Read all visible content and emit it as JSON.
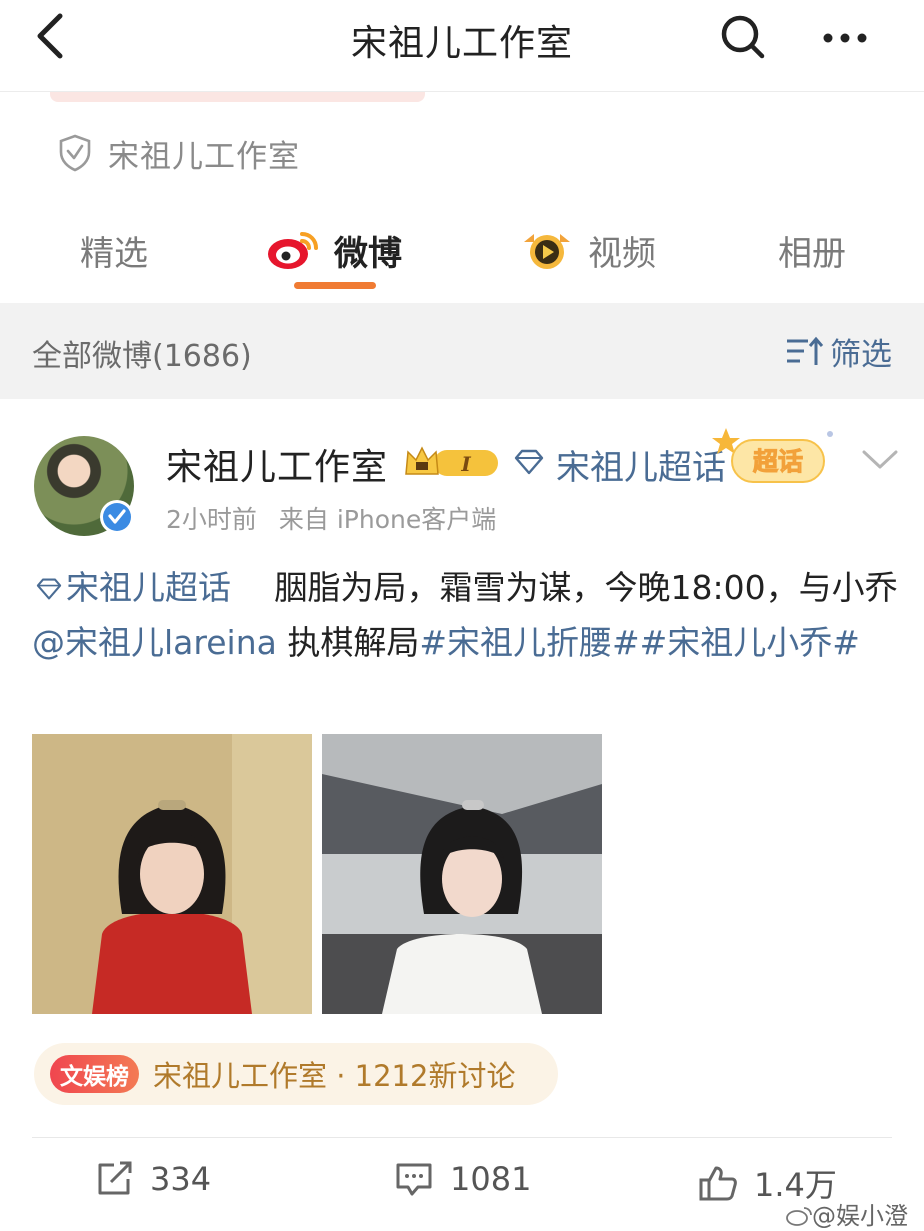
{
  "nav": {
    "title": "宋祖儿工作室",
    "back_icon": "back-arrow-icon",
    "search_icon": "search-icon",
    "more_icon": "more-icon"
  },
  "verification": {
    "label": "宋祖儿工作室",
    "icon": "shield-check-icon"
  },
  "tabs": [
    {
      "label": "精选",
      "active": false
    },
    {
      "label": "微博",
      "active": true,
      "icon": "weibo-logo-icon"
    },
    {
      "label": "视频",
      "active": false,
      "icon": "video-badge-icon"
    },
    {
      "label": "相册",
      "active": false
    }
  ],
  "filter_bar": {
    "count_label": "全部微博(1686)",
    "filter_label": "筛选"
  },
  "post": {
    "username": "宋祖儿工作室",
    "crown_level": "I",
    "super_topic": "宋祖儿超话",
    "chaohua_badge": "超话",
    "time": "2小时前",
    "source": "来自 iPhone客户端",
    "text_parts": {
      "topic": "宋祖儿超话",
      "plain1": "胭脂为局，霜雪为谋，今晚18:00，与小乔",
      "mention": "@宋祖儿lareina",
      "plain2": " 执棋解局",
      "hashtags": "#宋祖儿折腰##宋祖儿小乔#"
    },
    "rank": {
      "tag": "文娱榜",
      "text": "宋祖儿工作室 · 1212新讨论"
    },
    "actions": {
      "reposts": "334",
      "comments": "1081",
      "likes": "1.4万"
    }
  },
  "watermark": "@娱小澄",
  "colors": {
    "accent_orange": "#f07b33",
    "link_blue": "#4a6c94",
    "rank_gold": "#b07a2b"
  }
}
